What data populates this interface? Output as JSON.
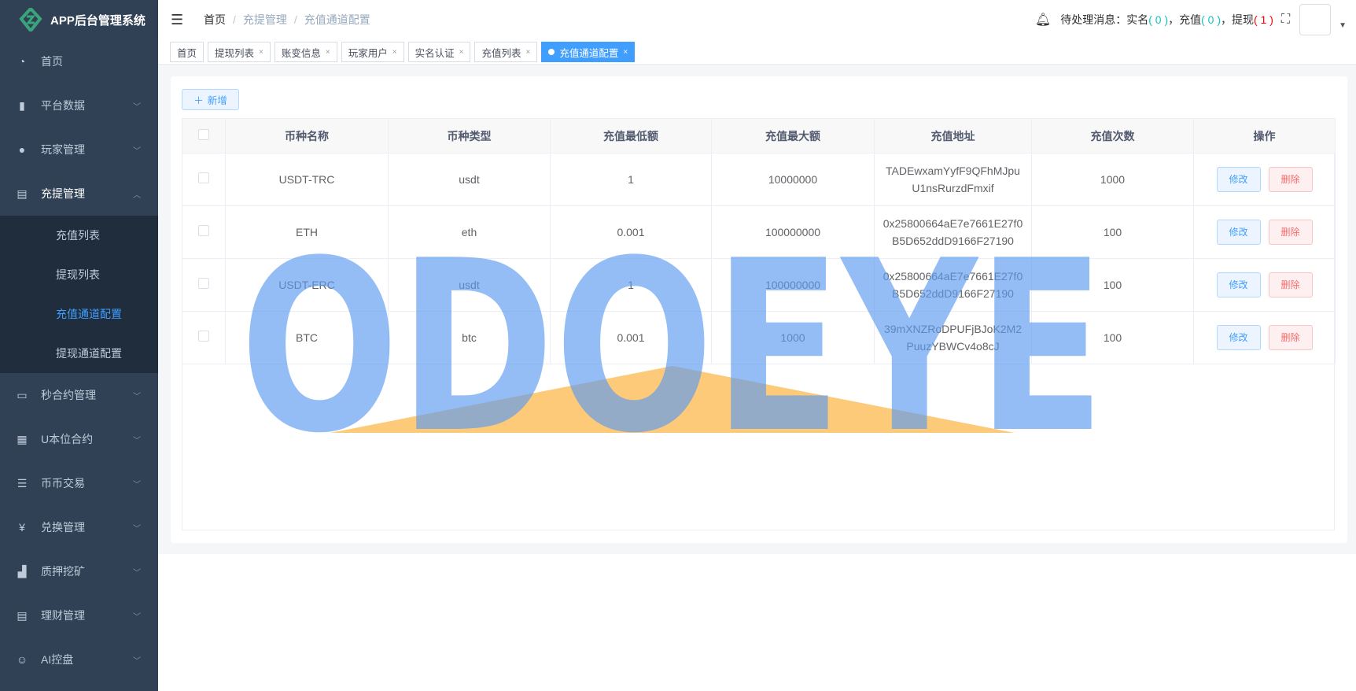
{
  "app": {
    "title": "APP后台管理系统"
  },
  "sidebar": {
    "items": [
      {
        "label": "首页",
        "icon": "dashboard-icon",
        "glyph": "◔"
      },
      {
        "label": "平台数据",
        "icon": "book-icon",
        "glyph": "▮"
      },
      {
        "label": "玩家管理",
        "icon": "user-icon",
        "glyph": "●"
      },
      {
        "label": "充提管理",
        "icon": "documents-icon",
        "glyph": "▤",
        "expanded": true,
        "children": [
          {
            "label": "充值列表"
          },
          {
            "label": "提现列表"
          },
          {
            "label": "充值通道配置",
            "active": true
          },
          {
            "label": "提现通道配置"
          }
        ]
      },
      {
        "label": "秒合约管理",
        "icon": "monitor-icon",
        "glyph": "▭"
      },
      {
        "label": "U本位合约",
        "icon": "grid-icon",
        "glyph": "▦"
      },
      {
        "label": "币币交易",
        "icon": "list-icon",
        "glyph": "☰"
      },
      {
        "label": "兑换管理",
        "icon": "yen-icon",
        "glyph": "¥"
      },
      {
        "label": "质押挖矿",
        "icon": "bar-chart-icon",
        "glyph": "▟"
      },
      {
        "label": "理财管理",
        "icon": "document-icon",
        "glyph": "▤"
      },
      {
        "label": "AI控盘",
        "icon": "robot-icon",
        "glyph": "☺"
      }
    ]
  },
  "header": {
    "breadcrumb": [
      "首页",
      "充提管理",
      "充值通道配置"
    ],
    "notice": {
      "prefix": "待处理消息：",
      "real_label": "实名",
      "real_count": "( 0 )",
      "sep": "，",
      "recharge_label": "充值",
      "recharge_count": "( 0 )",
      "withdraw_label": "提现",
      "withdraw_count": "( 1 )"
    }
  },
  "tags": [
    {
      "label": "首页",
      "closable": false
    },
    {
      "label": "提现列表"
    },
    {
      "label": "账变信息"
    },
    {
      "label": "玩家用户"
    },
    {
      "label": "实名认证"
    },
    {
      "label": "充值列表"
    },
    {
      "label": "充值通道配置",
      "active": true
    }
  ],
  "close_glyph": "×",
  "toolbar": {
    "add_label": "新增"
  },
  "table": {
    "columns": [
      "币种名称",
      "币种类型",
      "充值最低额",
      "充值最大额",
      "充值地址",
      "充值次数",
      "操作"
    ],
    "rows": [
      {
        "name": "USDT-TRC",
        "type": "usdt",
        "min": "1",
        "max": "10000000",
        "address": "TADEwxamYyfF9QFhMJpuU1nsRurzdFmxif",
        "count": "1000"
      },
      {
        "name": "ETH",
        "type": "eth",
        "min": "0.001",
        "max": "100000000",
        "address": "0x25800664aE7e7661E27f0B5D652ddD9166F27190",
        "count": "100"
      },
      {
        "name": "USDT-ERC",
        "type": "usdt",
        "min": "1",
        "max": "100000000",
        "address": "0x25800664aE7e7661E27f0B5D652ddD9166F27190",
        "count": "100"
      },
      {
        "name": "BTC",
        "type": "btc",
        "min": "0.001",
        "max": "1000",
        "address": "39mXNZRoDPUFjBJoK2M2PuuzYBWCv4o8cJ",
        "count": "100"
      }
    ],
    "edit_label": "修改",
    "delete_label": "删除"
  },
  "watermark": {
    "text": "ODOEYE"
  },
  "colors": {
    "primary": "#409eff",
    "sidebar": "#304156",
    "danger": "#f56c6c",
    "success": "#13c2c2"
  }
}
